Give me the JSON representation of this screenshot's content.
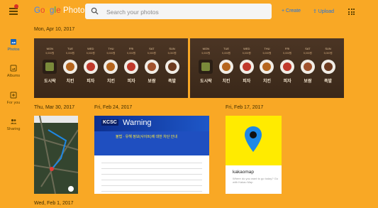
{
  "app": {
    "logo_google": "Google",
    "logo_photos": "Photos",
    "notification_color": "#d93025"
  },
  "search": {
    "placeholder": "Search your photos"
  },
  "actions": {
    "create": "+ Create",
    "upload": "⇪ Upload"
  },
  "sidebar": {
    "items": [
      {
        "label": "Photos",
        "icon": "photos-icon",
        "active": true
      },
      {
        "label": "Albums",
        "icon": "albums-icon",
        "active": false
      },
      {
        "label": "For you",
        "icon": "for-you-icon",
        "active": false
      },
      {
        "label": "Sharing",
        "icon": "sharing-icon",
        "active": false
      }
    ]
  },
  "groups": [
    {
      "date": "Mon, Apr 10, 2017"
    },
    {
      "date": "Thu, Mar 30, 2017"
    },
    {
      "date": "Fri, Feb 24, 2017"
    },
    {
      "date": "Fri, Feb 17, 2017"
    },
    {
      "date": "Wed, Feb 1, 2017"
    }
  ],
  "banner": {
    "days": [
      "MON",
      "TUE",
      "WED",
      "THU",
      "FRI",
      "SAT",
      "SUN"
    ],
    "price": "5,000원",
    "dishes": [
      "도시락",
      "치킨",
      "피자",
      "치킨",
      "피자",
      "보쌈",
      "족발"
    ]
  },
  "warning": {
    "badge": "KCSC",
    "title": "Warning",
    "notice": "불법 · 유해 정보(사이트)에 대한 차단 안내"
  },
  "kakao": {
    "name": "kakaomap",
    "tagline": "Where do you want to go today? Go with Kakao Map"
  },
  "colors": {
    "background": "#f9a825",
    "accent": "#1a73e8",
    "kakao_yellow": "#ffeb00",
    "pin_blue": "#1e88e5"
  }
}
